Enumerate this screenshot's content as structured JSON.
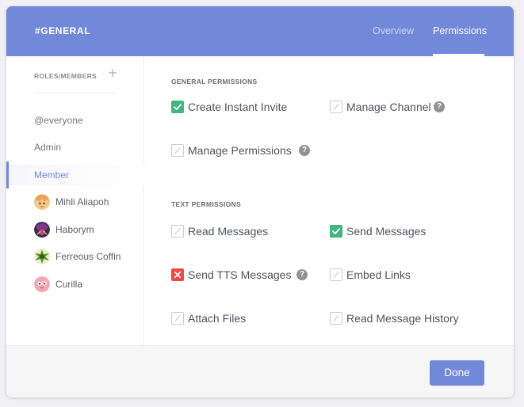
{
  "header": {
    "channel_name": "#GENERAL",
    "tabs": [
      {
        "label": "Overview"
      },
      {
        "label": "Permissions"
      }
    ]
  },
  "sidebar": {
    "title": "ROLES/MEMBERS",
    "add_icon": "plus-icon",
    "roles": [
      {
        "label": "@everyone"
      },
      {
        "label": "Admin"
      },
      {
        "label": "Member"
      }
    ],
    "active_role": "Member",
    "members": [
      {
        "label": "Mihli Aliapoh"
      },
      {
        "label": "Haborym"
      },
      {
        "label": "Ferreous Coffin"
      },
      {
        "label": "Curilla"
      }
    ]
  },
  "general_permissions": {
    "title": "GENERAL PERMISSIONS",
    "items": [
      {
        "label": "Create Instant Invite",
        "state": "allowed"
      },
      {
        "label": "Manage Channel",
        "state": "neutral",
        "help": "?"
      },
      {
        "label": "Manage Permissions",
        "state": "neutral",
        "help": "?"
      }
    ]
  },
  "text_permissions": {
    "title": "TEXT PERMISSIONS",
    "items": [
      {
        "label": "Read Messages",
        "state": "neutral"
      },
      {
        "label": "Send Messages",
        "state": "allowed"
      },
      {
        "label": "Send TTS Messages",
        "state": "denied",
        "help": "?"
      },
      {
        "label": "Embed Links",
        "state": "neutral"
      },
      {
        "label": "Attach Files",
        "state": "neutral"
      },
      {
        "label": "Read Message History",
        "state": "neutral"
      }
    ]
  },
  "footer": {
    "done_label": "Done"
  },
  "colors": {
    "accent": "#7289da",
    "allowed": "#43b581",
    "denied": "#f04747"
  }
}
